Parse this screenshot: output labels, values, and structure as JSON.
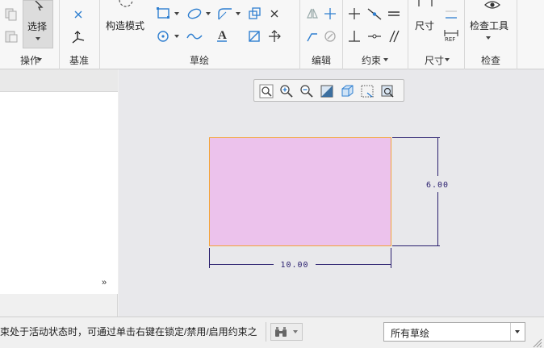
{
  "ribbon": {
    "groups": [
      {
        "label": "操作"
      },
      {
        "label": "基准"
      },
      {
        "label": "草绘"
      },
      {
        "label": "编辑"
      },
      {
        "label": "约束"
      },
      {
        "label": "尺寸"
      },
      {
        "label": "检查"
      }
    ],
    "buttons": {
      "select": "选择",
      "construction_mode": "构造模式",
      "dimension": "尺寸",
      "inspect_tools": "检查工具"
    },
    "small_labels": {
      "text_icon": "A",
      "ref_icon": "REF"
    }
  },
  "left_panel": {
    "collapse_glyph": "»"
  },
  "graphics": {
    "colors": {
      "rect_fill": "#ecc2ec",
      "rect_edge": "#f3a33a",
      "dimension": "#2a1f6e",
      "background": "#e8e8eb"
    },
    "dimensions": {
      "width": "10.00",
      "height": "6.00"
    },
    "view_toolbar": {
      "icons": [
        "refit-icon",
        "zoom-in-icon",
        "zoom-out-icon",
        "repaint-icon",
        "display-style-icon",
        "sketch-display-filter-icon",
        "named-views-icon"
      ]
    }
  },
  "statusbar": {
    "message": "束处于活动状态时，可通过单击右键在锁定/禁用/启用约束之",
    "filter": {
      "selected": "所有草绘"
    }
  }
}
